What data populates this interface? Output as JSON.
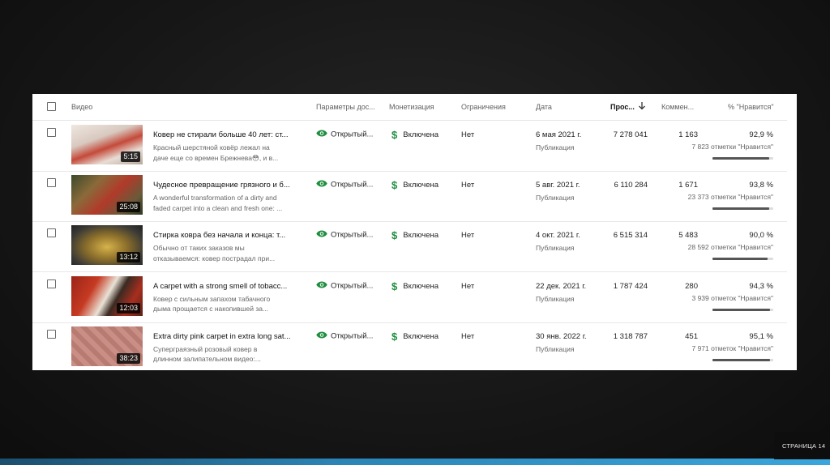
{
  "header": {
    "video": "Видео",
    "visibility": "Параметры дос...",
    "monetization": "Монетизация",
    "restrictions": "Ограничения",
    "date": "Дата",
    "views": "Прос...",
    "comments": "Коммен...",
    "likes": "% \"Нравится\""
  },
  "colors": {
    "accent_green": "#1e8e3e",
    "footer_blue": "#2b84b5"
  },
  "rows": [
    {
      "duration": "5:15",
      "title": "Ковер не стирали больше 40 лет: ст...",
      "desc_1": "Красный шерстяной ковёр лежал на",
      "desc_2": "даче еще со времен Брежнева😳, и в...",
      "visibility": "Открытый...",
      "monetization": "Включена",
      "restrictions": "Нет",
      "date": "6 мая 2021 г.",
      "date_sub": "Публикация",
      "views": "7 278 041",
      "comments": "1 163",
      "like_pct": "92,9 %",
      "like_count": "7 823 отметки \"Нравится\"",
      "like_fraction": 0.929
    },
    {
      "duration": "25:08",
      "title": "Чудесное превращение грязного и б...",
      "desc_1": "A wonderful transformation of a dirty and",
      "desc_2": "faded carpet into a clean and fresh one: ...",
      "visibility": "Открытый...",
      "monetization": "Включена",
      "restrictions": "Нет",
      "date": "5 авг. 2021 г.",
      "date_sub": "Публикация",
      "views": "6 110 284",
      "comments": "1 671",
      "like_pct": "93,8 %",
      "like_count": "23 373 отметки \"Нравится\"",
      "like_fraction": 0.938
    },
    {
      "duration": "13:12",
      "title": "Стирка ковра без начала и конца: т...",
      "desc_1": "Обычно от таких заказов мы",
      "desc_2": "отказываемся: ковер пострадал при...",
      "visibility": "Открытый...",
      "monetization": "Включена",
      "restrictions": "Нет",
      "date": "4 окт. 2021 г.",
      "date_sub": "Публикация",
      "views": "6 515 314",
      "comments": "5 483",
      "like_pct": "90,0 %",
      "like_count": "28 592 отметки \"Нравится\"",
      "like_fraction": 0.9
    },
    {
      "duration": "12:03",
      "title": "A carpet with a strong smell of tobacc...",
      "desc_1": "Ковер с сильным запахом табачного",
      "desc_2": "дыма прощается с накопившей за...",
      "visibility": "Открытый...",
      "monetization": "Включена",
      "restrictions": "Нет",
      "date": "22 дек. 2021 г.",
      "date_sub": "Публикация",
      "views": "1 787 424",
      "comments": "280",
      "like_pct": "94,3 %",
      "like_count": "3 939 отметок \"Нравится\"",
      "like_fraction": 0.943
    },
    {
      "duration": "38:23",
      "title": "Extra dirty pink carpet in extra long sat...",
      "desc_1": "Суперграязный розовый ковер в",
      "desc_2": "длинном залипательном видео:...",
      "visibility": "Открытый...",
      "monetization": "Включена",
      "restrictions": "Нет",
      "date": "30 янв. 2022 г.",
      "date_sub": "Публикация",
      "views": "1 318 787",
      "comments": "451",
      "like_pct": "95,1 %",
      "like_count": "7 971 отметок \"Нравится\"",
      "like_fraction": 0.951
    }
  ],
  "footer": {
    "page_label": "СТРАНИЦА 14"
  }
}
